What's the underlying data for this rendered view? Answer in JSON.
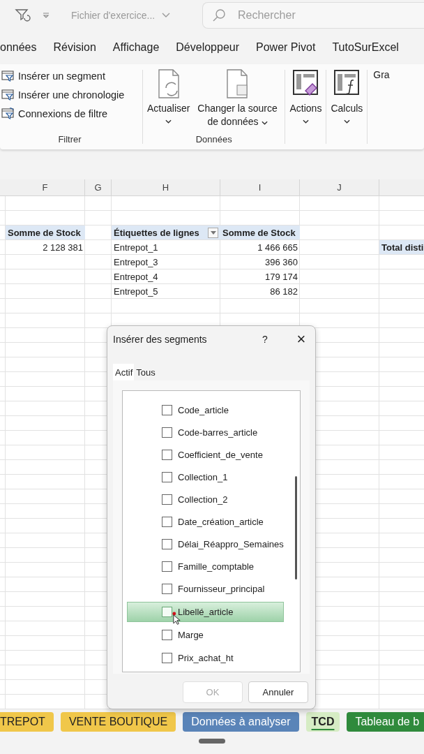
{
  "title_bar": {
    "file_name": "Fichier d'exercice...",
    "search": {
      "placeholder": "Rechercher"
    }
  },
  "menu_tabs": [
    {
      "label": "onnées"
    },
    {
      "label": "Révision"
    },
    {
      "label": "Affichage"
    },
    {
      "label": "Développeur"
    },
    {
      "label": "Power Pivot"
    },
    {
      "label": "TutoSurExcel"
    }
  ],
  "ribbon": {
    "groups": [
      {
        "label": "Filtrer",
        "kind": "list",
        "items": [
          {
            "label": "Insérer un segment"
          },
          {
            "label": "Insérer une chronologie"
          },
          {
            "label": "Connexions de filtre"
          }
        ]
      },
      {
        "label": "Données",
        "kind": "large",
        "items": [
          {
            "label": "Actualiser",
            "has_menu": true
          },
          {
            "label": "Changer la source de données",
            "has_menu": true
          }
        ]
      },
      {
        "kind": "large",
        "items": [
          {
            "label": "Actions",
            "has_menu": true
          }
        ]
      },
      {
        "kind": "large",
        "items": [
          {
            "label": "Calculs",
            "has_menu": true
          }
        ]
      },
      {
        "kind": "large",
        "items": [
          {
            "label": "Gra",
            "has_menu": false
          }
        ]
      }
    ]
  },
  "sheet": {
    "columns": [
      "F",
      "G",
      "H",
      "I",
      "J"
    ],
    "rows": [
      {
        "cells": [
          {
            "text": "Somme de Stock",
            "kind": "header"
          },
          null,
          {
            "text": "Étiquettes de lignes",
            "kind": "header",
            "filter_button": true
          },
          {
            "text": "Somme de Stock",
            "kind": "header"
          },
          null,
          null
        ]
      },
      {
        "cells": [
          {
            "text": "2 128 381",
            "kind": "number"
          },
          null,
          {
            "text": "Entrepot_1",
            "kind": "label"
          },
          {
            "text": "1 466 665",
            "kind": "number"
          },
          null,
          {
            "text": "Total disti",
            "kind": "header"
          }
        ]
      },
      {
        "cells": [
          null,
          null,
          {
            "text": "Entrepot_3",
            "kind": "label"
          },
          {
            "text": "396 360",
            "kind": "number"
          },
          null,
          null
        ]
      },
      {
        "cells": [
          null,
          null,
          {
            "text": "Entrepot_4",
            "kind": "label"
          },
          {
            "text": "179 174",
            "kind": "number"
          },
          null,
          null
        ]
      },
      {
        "cells": [
          null,
          null,
          {
            "text": "Entrepot_5",
            "kind": "label"
          },
          {
            "text": "86 182",
            "kind": "number"
          },
          null,
          null
        ]
      }
    ]
  },
  "dialog": {
    "title": "Insérer des segments",
    "help": "?",
    "close": "×",
    "tabs": [
      {
        "label": "Actif",
        "selected": true
      },
      {
        "label": "Tous",
        "selected": false
      }
    ],
    "fields": [
      {
        "label": "Code_article",
        "checked": false,
        "highlighted": false
      },
      {
        "label": "Code-barres_article",
        "checked": false,
        "highlighted": false
      },
      {
        "label": "Coefficient_de_vente",
        "checked": false,
        "highlighted": false
      },
      {
        "label": "Collection_1",
        "checked": false,
        "highlighted": false
      },
      {
        "label": "Collection_2",
        "checked": false,
        "highlighted": false
      },
      {
        "label": "Date_création_article",
        "checked": false,
        "highlighted": false
      },
      {
        "label": "Délai_Réappro_Semaines",
        "checked": false,
        "highlighted": false
      },
      {
        "label": "Famille_comptable",
        "checked": false,
        "highlighted": false
      },
      {
        "label": "Fournisseur_principal",
        "checked": false,
        "highlighted": false
      },
      {
        "label": "Libellé_article",
        "checked": false,
        "highlighted": true
      },
      {
        "label": "Marge",
        "checked": false,
        "highlighted": false
      },
      {
        "label": "Prix_achat_ht",
        "checked": false,
        "highlighted": false
      }
    ],
    "buttons": [
      {
        "label": "OK",
        "disabled": true
      },
      {
        "label": "Annuler",
        "disabled": false
      }
    ]
  },
  "sheet_tabs": [
    {
      "label": "TREPOT",
      "color": "#f0c74a",
      "selected": false
    },
    {
      "label": "VENTE BOUTIQUE",
      "color": "#f0c74a",
      "selected": false
    },
    {
      "label": "Données à analyser",
      "color": "#5a84b8",
      "selected": false
    },
    {
      "label": "TCD",
      "color": "#d6ecc4",
      "selected": true
    },
    {
      "label": "Tableau de b",
      "color": "#2f8a3c",
      "selected": false
    }
  ]
}
